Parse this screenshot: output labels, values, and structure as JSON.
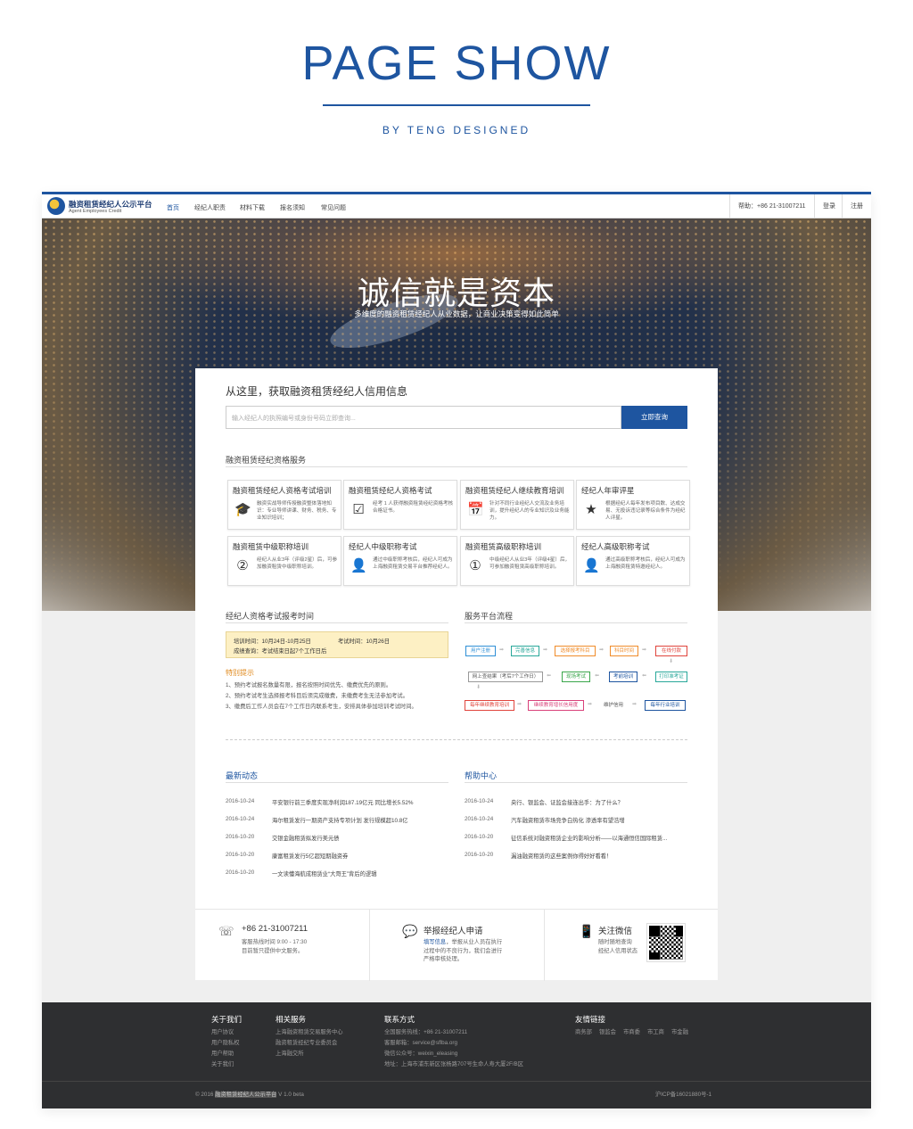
{
  "showcase": {
    "title": "PAGE SHOW",
    "subtitle": "BY TENG DESIGNED"
  },
  "nav": {
    "logo_cn": "融资租赁经纪人公示平台",
    "logo_en": "Agent Employees Credit",
    "items": [
      "首页",
      "经纪人职责",
      "材料下载",
      "报名须知",
      "常见问题"
    ],
    "help": "帮助：+86 21-31007211",
    "login": "登录",
    "register": "注册"
  },
  "hero": {
    "title": "诚信就是资本",
    "subtitle": "多维度的融资租赁经纪人从业数据，让商业决策变得如此简单"
  },
  "search": {
    "title": "从这里，获取融资租赁经纪人信用信息",
    "placeholder": "输入经纪人的执照编号或身份号码立即查询...",
    "button": "立即查询"
  },
  "services": {
    "title": "融资租赁经纪资格服务",
    "items": [
      {
        "title": "融资租赁经纪人资格考试培训",
        "desc": "融资实战导师传授融资整体落地知识：专业导师讲课、财务、税务、专业知识培训；",
        "icon": "graduation-cap-icon"
      },
      {
        "title": "融资租赁经纪人资格考试",
        "desc": "经考 1 人获得融资租赁经纪资格考核合格证书。",
        "icon": "checkbox-icon"
      },
      {
        "title": "融资租赁经纪人继续教育培训",
        "desc": "针对不同行业经纪人交流及业务培训，提升经纪人的专业知识及业务能力。",
        "icon": "calendar-icon"
      },
      {
        "title": "经纪人年审评星",
        "desc": "根据经纪人每年发布项目数、达成交易、无投诉违记录等综合条件为经纪人评星。",
        "icon": "star-icon"
      },
      {
        "title": "融资租赁中级职称培训",
        "desc": "经纪人从业3年（评级2星）后，可参加融资租赁中级职称培训。",
        "icon": "badge-2-icon"
      },
      {
        "title": "经纪人中级职称考试",
        "desc": "通过中级职称考核后，经纪人可成为上海融资租赁交易平台推荐经纪人。",
        "icon": "person-2-icon"
      },
      {
        "title": "融资租赁高级职称培训",
        "desc": "中级经纪人从业3年（评级4星）后，可参加融资租赁高级职称培训。",
        "icon": "badge-1-icon"
      },
      {
        "title": "经纪人高级职称考试",
        "desc": "通过高级职称考核后，经纪人可成为上海融资租赁特邀经纪人。",
        "icon": "person-1-icon"
      }
    ]
  },
  "exam": {
    "title": "经纪人资格考试报考时间",
    "training": "培训时间：10月24日-10月25日",
    "test": "考试时间：10月26日",
    "result": "成绩查询：考试结束日起7个工作日后",
    "notice_title": "特别提示",
    "notices": [
      "1、预约考试报名数量有限，报名按照时间优先、缴费优先的原则。",
      "2、预约考试考生选择报考科目后须完成缴费，未缴费考生无法参加考试。",
      "3、缴费后工作人员会在7个工作日内联系考生，安排具体参加培训考试时间。"
    ]
  },
  "flow": {
    "title": "服务平台流程",
    "row1": [
      "用户注册",
      "完善信息",
      "选择报考科目",
      "科目时间",
      "在线付款"
    ],
    "row2": [
      "网上查结果（考后7个工作日）",
      "现场考试",
      "考前培训",
      "打印准考证"
    ],
    "row3": [
      "每年继续教育培训",
      "继续教育增长信用度",
      "维护信用",
      "每年行业培训"
    ],
    "colors": {
      "blue": "#2f8fd6",
      "teal": "#29a89a",
      "orange": "#f08c2a",
      "red": "#e0443c",
      "green": "#3aa64b",
      "navy": "#1e55a0",
      "pink": "#d9417a",
      "gray": "#999999"
    }
  },
  "news": {
    "title": "最新动态",
    "items": [
      {
        "date": "2016-10-24",
        "text": "平安银行前三季度实现净利润187.19亿元 同比增长5.52%"
      },
      {
        "date": "2016-10-24",
        "text": "海尔租赁发行一期资产支持专项计划 发行规模超10.8亿"
      },
      {
        "date": "2016-10-20",
        "text": "交银金融租赁拟发行美元债"
      },
      {
        "date": "2016-10-20",
        "text": "康富租赁发行5亿超短期融资券"
      },
      {
        "date": "2016-10-20",
        "text": "一文读懂海航成租赁业“大哥王”背后的逻辑"
      }
    ]
  },
  "help_center": {
    "title": "帮助中心",
    "items": [
      {
        "date": "2016-10-24",
        "text": "央行、银监会、证监会接连出手：为了什么？"
      },
      {
        "date": "2016-10-24",
        "text": "汽车融资租赁市场竞争白热化 渗透率有望浩增"
      },
      {
        "date": "2016-10-20",
        "text": "征信系统对融资租赁企业的影响分析——以海通恒信国际租赁..."
      },
      {
        "date": "2016-10-20",
        "text": "漏油融资租赁的这些案例你得好好看看！"
      }
    ]
  },
  "contact": {
    "phone": "+86 21-31007211",
    "hours": "客服热线时间 9:00 - 17:30",
    "lang": "目前暂只提供中文服务。",
    "report_title": "举报经纪人申请",
    "report_link": "填写信息",
    "report_desc1": "，举报从业人员在执行",
    "report_desc2": "过程中的不良行为，我们会进行",
    "report_desc3": "严格审核处理。",
    "wechat_title": "关注微信",
    "wechat_desc1": "随时随地查询",
    "wechat_desc2": "经纪人信用状态"
  },
  "footer": {
    "about_title": "关于我们",
    "about": [
      "用户协议",
      "用户隐私权",
      "用户帮助",
      "关于我们"
    ],
    "services_title": "相关服务",
    "services": [
      "上海融资租赁交易服务中心",
      "融资租赁经纪专业委员会",
      "上海融交所"
    ],
    "contact_title": "联系方式",
    "contact": [
      "全国服务热线：+86 21-31007211",
      "客服邮箱：service@sflba.org",
      "微信公众号：weixin_eleasing",
      "地址：上海市浦东新区张杨路707号生命人寿大厦2F/B区"
    ],
    "links_title": "友情链接",
    "links": [
      "商务部",
      "银监会",
      "市商委",
      "市工商",
      "市金融"
    ],
    "copyright_pre": "© 2016 ",
    "copyright_site": "融资租赁经纪人公示平台",
    "copyright_post": " V 1.0 beta",
    "icp": "沪ICP备16021880号-1"
  }
}
